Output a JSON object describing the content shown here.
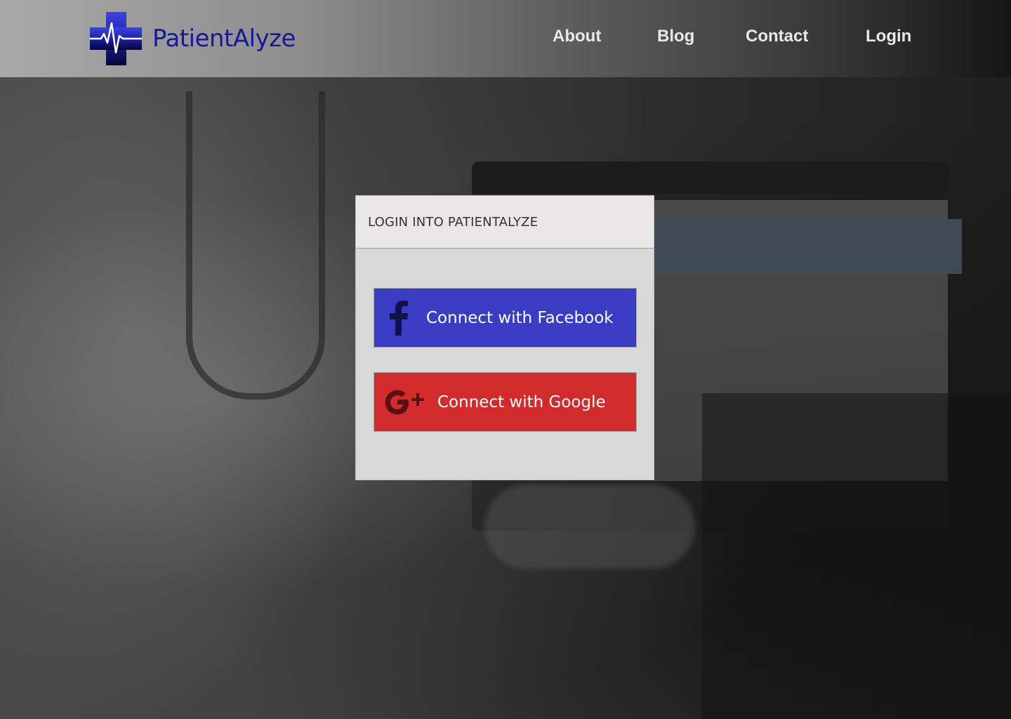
{
  "brand": {
    "name": "PatientAlyze",
    "logo_icon": "medical-cross-heartbeat-icon",
    "color": "#15199a"
  },
  "nav": {
    "items": [
      {
        "label": "About"
      },
      {
        "label": "Blog"
      },
      {
        "label": "Contact"
      },
      {
        "label": "Login"
      }
    ]
  },
  "login_modal": {
    "title": "LOGIN INTO PATIENTALYZE",
    "buttons": {
      "facebook": {
        "label": "Connect with Facebook",
        "icon": "facebook-icon",
        "color": "#3a3cc4"
      },
      "google": {
        "label": "Connect with Google",
        "icon": "google-plus-icon",
        "color": "#d22b2b"
      }
    }
  }
}
